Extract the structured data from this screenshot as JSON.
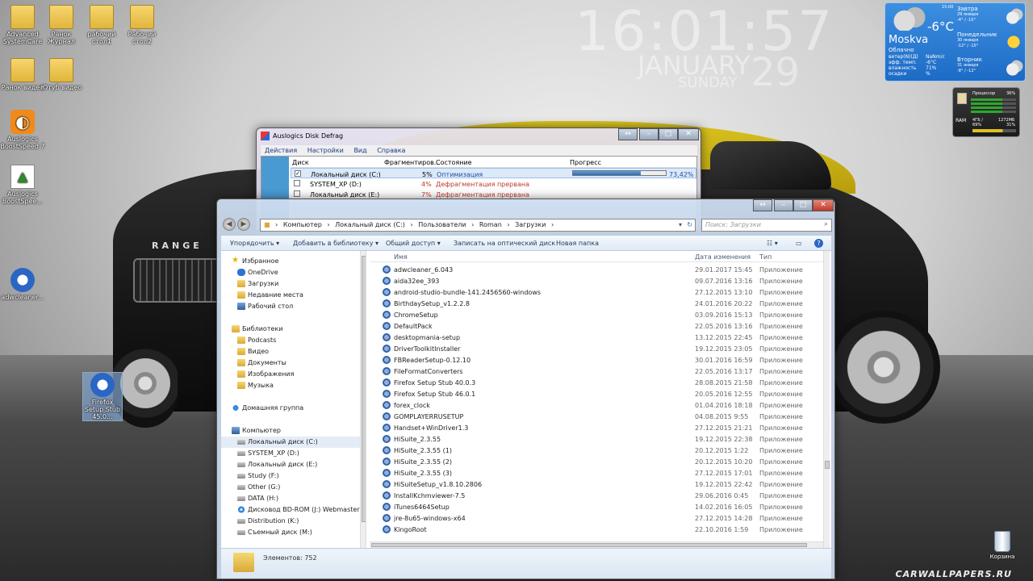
{
  "clock": {
    "time": "16:01:57",
    "month": "JANUARY",
    "day": "29",
    "weekday": "SUNDAY"
  },
  "desktop_icons": [
    {
      "label": "Advanced SystemCare"
    },
    {
      "label": "Ранок Журнал"
    },
    {
      "label": "рабочий стол1"
    },
    {
      "label": "Рабочий стол2"
    },
    {
      "label": "Ранок видео"
    },
    {
      "label": "Ютуб видео"
    },
    {
      "label": "Auslogics BoostSpeed 7"
    },
    {
      "label": "Auslogics BoostSpee..."
    },
    {
      "label": "adwcleaner..."
    },
    {
      "label": "Firefox Setup Stub 45.0..."
    }
  ],
  "weather": {
    "time": "15:00",
    "temp": "-6°C",
    "city": "Moskva",
    "condition": "Облачно",
    "stats": [
      {
        "k": "ветер(N)(Д)",
        "v": "NaNm/c"
      },
      {
        "k": "эфф. темп.",
        "v": "-6°C"
      },
      {
        "k": "влажность",
        "v": "71%"
      },
      {
        "k": "осадки",
        "v": "%"
      }
    ],
    "forecast": [
      {
        "day": "Завтра",
        "date": "29 января",
        "range": "-4° / -15°",
        "icon": "cloud-icon"
      },
      {
        "day": "Понедельник",
        "date": "30 января",
        "range": "-12° / -15°",
        "icon": "sun-icon"
      },
      {
        "day": "Вторник",
        "date": "31 января",
        "range": "-8° / -12°",
        "icon": "cloud-icon"
      }
    ]
  },
  "cpu": {
    "title": "Процессор",
    "cpu_percent": "36%",
    "ram_label": "RAM",
    "ram_total": "4ГБ /",
    "ram_used": "1272МБ",
    "ram_pct1": "69%",
    "ram_pct2": "31%"
  },
  "recycle_bin": "Корзина",
  "watermark": "CARWALLPAPERS.RU",
  "defrag": {
    "title": "Auslogics Disk Defrag",
    "menu": [
      "Действия",
      "Настройки",
      "Вид",
      "Справка"
    ],
    "columns": [
      "Диск",
      "Фрагментиров...",
      "Состояние",
      "Прогресс"
    ],
    "rows": [
      {
        "name": "Локальный диск (C:)",
        "frag": "5%",
        "state": "Оптимизация",
        "progress": 0.7342,
        "progress_text": "73,42%",
        "checked": "✓"
      },
      {
        "name": "SYSTEM_XP (D:)",
        "frag": "4%",
        "state": "Дефрагментация прервана"
      },
      {
        "name": "Локальный диск (E:)",
        "frag": "7%",
        "state": "Дефрагментация прервана"
      }
    ]
  },
  "explorer": {
    "breadcrumb": [
      "Компьютер",
      "Локальный диск (C:)",
      "Пользователи",
      "Roman",
      "Загрузки"
    ],
    "search_placeholder": "Поиск: Загрузки",
    "toolbar": [
      "Упорядочить ▾",
      "Добавить в библиотеку ▾",
      "Общий доступ ▾",
      "Записать на оптический диск",
      "Новая папка"
    ],
    "nav": {
      "favorites": "Избранное",
      "fav_items": [
        "OneDrive",
        "Загрузки",
        "Недавние места",
        "Рабочий стол"
      ],
      "libraries": "Библиотеки",
      "lib_items": [
        "Podcasts",
        "Видео",
        "Документы",
        "Изображения",
        "Музыка"
      ],
      "homegroup": "Домашняя группа",
      "computer": "Компьютер",
      "drives": [
        "Локальный диск (C:)",
        "SYSTEM_XP (D:)",
        "Локальный диск (E:)",
        "Study (F:)",
        "Other (G:)",
        "DATA (H:)",
        "Дисковод BD-ROM (J:) WebmasterDVD6",
        "Distribution (K:)",
        "Съемный диск (M:)"
      ]
    },
    "columns": [
      "Имя",
      "Дата изменения",
      "Тип"
    ],
    "files": [
      {
        "name": "adwcleaner_6.043",
        "date": "29.01.2017 15:45",
        "type": "Приложение"
      },
      {
        "name": "aida32ee_393",
        "date": "09.07.2016 13:16",
        "type": "Приложение"
      },
      {
        "name": "android-studio-bundle-141.2456560-windows",
        "date": "27.12.2015 13:10",
        "type": "Приложение"
      },
      {
        "name": "BirthdaySetup_v1.2.2.8",
        "date": "24.01.2016 20:22",
        "type": "Приложение"
      },
      {
        "name": "ChromeSetup",
        "date": "03.09.2016 15:13",
        "type": "Приложение"
      },
      {
        "name": "DefaultPack",
        "date": "22.05.2016 13:16",
        "type": "Приложение"
      },
      {
        "name": "desktopmania-setup",
        "date": "13.12.2015 22:45",
        "type": "Приложение"
      },
      {
        "name": "DriverToolkitInstaller",
        "date": "19.12.2015 23:05",
        "type": "Приложение"
      },
      {
        "name": "FBReaderSetup-0.12.10",
        "date": "30.01.2016 16:59",
        "type": "Приложение"
      },
      {
        "name": "FileFormatConverters",
        "date": "22.05.2016 13:17",
        "type": "Приложение"
      },
      {
        "name": "Firefox Setup Stub 40.0.3",
        "date": "28.08.2015 21:58",
        "type": "Приложение"
      },
      {
        "name": "Firefox Setup Stub 46.0.1",
        "date": "20.05.2016 12:55",
        "type": "Приложение"
      },
      {
        "name": "forex_clock",
        "date": "01.04.2016 18:18",
        "type": "Приложение"
      },
      {
        "name": "GOMPLAYERRUSETUP",
        "date": "04.08.2015 9:55",
        "type": "Приложение"
      },
      {
        "name": "Handset+WinDriver1.3",
        "date": "27.12.2015 21:21",
        "type": "Приложение"
      },
      {
        "name": "HiSuite_2.3.55",
        "date": "19.12.2015 22:38",
        "type": "Приложение"
      },
      {
        "name": "HiSuite_2.3.55 (1)",
        "date": "20.12.2015 1:22",
        "type": "Приложение"
      },
      {
        "name": "HiSuite_2.3.55 (2)",
        "date": "20.12.2015 10:20",
        "type": "Приложение"
      },
      {
        "name": "HiSuite_2.3.55 (3)",
        "date": "27.12.2015 17:01",
        "type": "Приложение"
      },
      {
        "name": "HiSuiteSetup_v1.8.10.2806",
        "date": "19.12.2015 22:42",
        "type": "Приложение"
      },
      {
        "name": "InstallKchmviewer-7.5",
        "date": "29.06.2016 0:45",
        "type": "Приложение"
      },
      {
        "name": "iTunes6464Setup",
        "date": "14.02.2016 16:05",
        "type": "Приложение"
      },
      {
        "name": "jre-8u65-windows-x64",
        "date": "27.12.2015 14:28",
        "type": "Приложение"
      },
      {
        "name": "KingoRoot",
        "date": "22.10.2016 1:59",
        "type": "Приложение"
      }
    ],
    "status": "Элементов: 752"
  }
}
